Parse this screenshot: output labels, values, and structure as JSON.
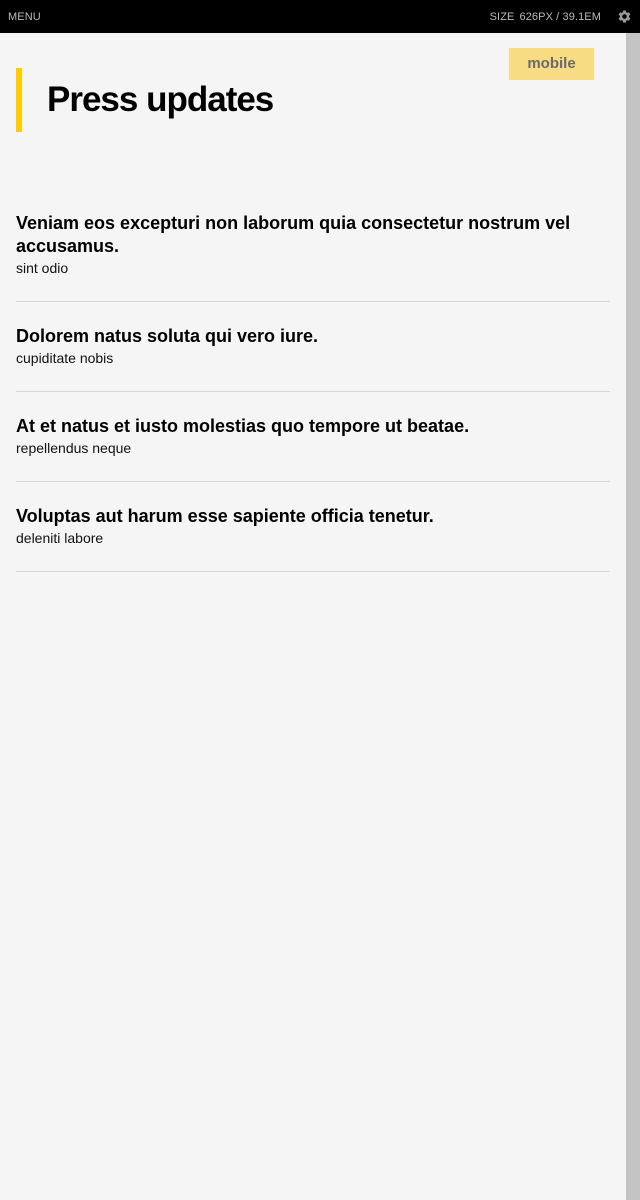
{
  "topbar": {
    "menu_label": "MENU",
    "size_label": "SIZE",
    "size_value": "626PX / 39.1EM",
    "settings_icon": "gear-icon"
  },
  "badge": {
    "label": "mobile",
    "color": "#f7dc83"
  },
  "page": {
    "title": "Press updates",
    "accent_color": "#ffcc00"
  },
  "articles": [
    {
      "title": "Veniam eos excepturi non laborum quia consectetur nostrum vel accusamus.",
      "subtitle": "sint odio"
    },
    {
      "title": "Dolorem natus soluta qui vero iure.",
      "subtitle": "cupiditate nobis"
    },
    {
      "title": "At et natus et iusto molestias quo tempore ut beatae.",
      "subtitle": "repellendus neque"
    },
    {
      "title": "Voluptas aut harum esse sapiente officia tenetur.",
      "subtitle": "deleniti labore"
    }
  ]
}
